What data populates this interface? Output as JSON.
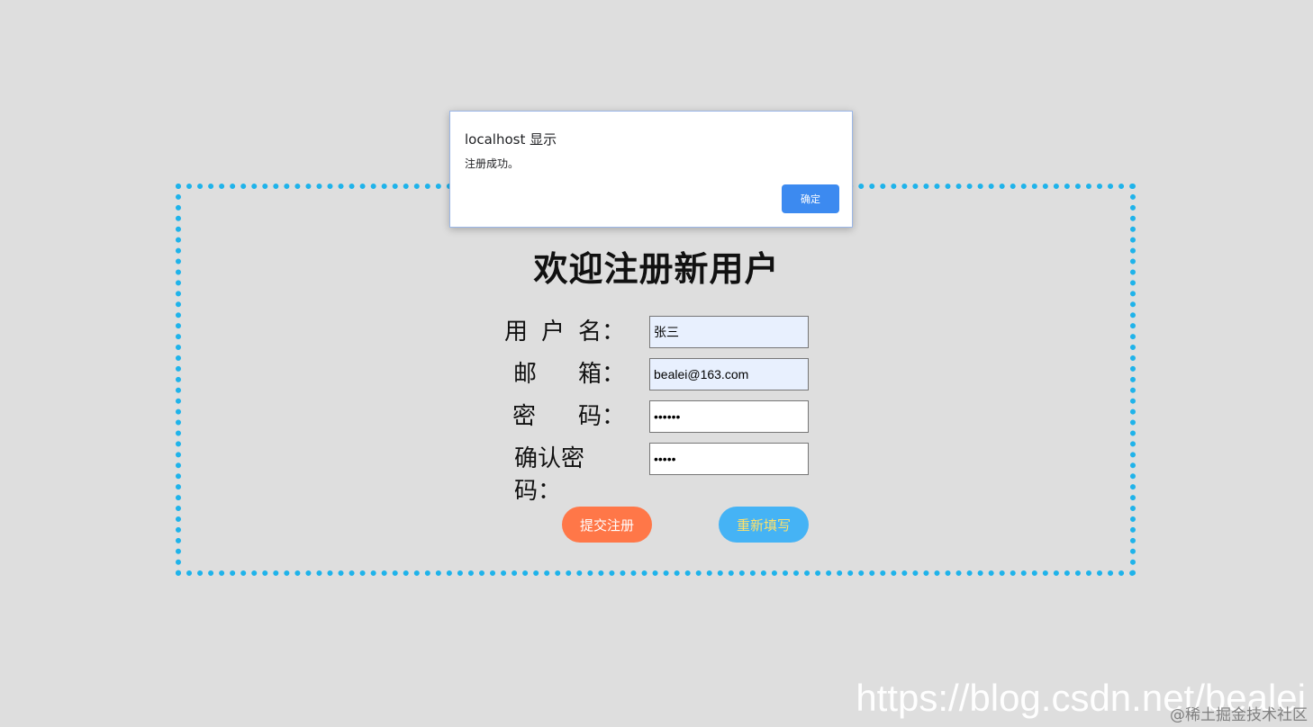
{
  "form": {
    "title": "欢迎注册新用户",
    "fields": [
      {
        "label_chars": [
          "用",
          "户",
          "名："
        ],
        "value": "张三",
        "type": "text"
      },
      {
        "label_chars": [
          "邮",
          "箱："
        ],
        "value": "bealei@163.com",
        "type": "text"
      },
      {
        "label_chars": [
          "密",
          "码："
        ],
        "value": "••••••",
        "type": "password"
      },
      {
        "label_chars": [
          "确认密码："
        ],
        "value": "•••••",
        "type": "password"
      }
    ],
    "submit_label": "提交注册",
    "reset_label": "重新填写"
  },
  "dialog": {
    "title": "localhost 显示",
    "message": "注册成功。",
    "ok_label": "确定"
  },
  "watermark": {
    "url": "https://blog.csdn.net/bealei",
    "community": "@稀土掘金技术社区"
  },
  "colors": {
    "background": "#dedede",
    "panel_border": "#1fb3ea",
    "submit_button": "#ff7748",
    "reset_button": "#45b3f5",
    "reset_text": "#ffe16a",
    "dialog_ok": "#3c8af0",
    "autofill_input": "#e8f0fe"
  }
}
